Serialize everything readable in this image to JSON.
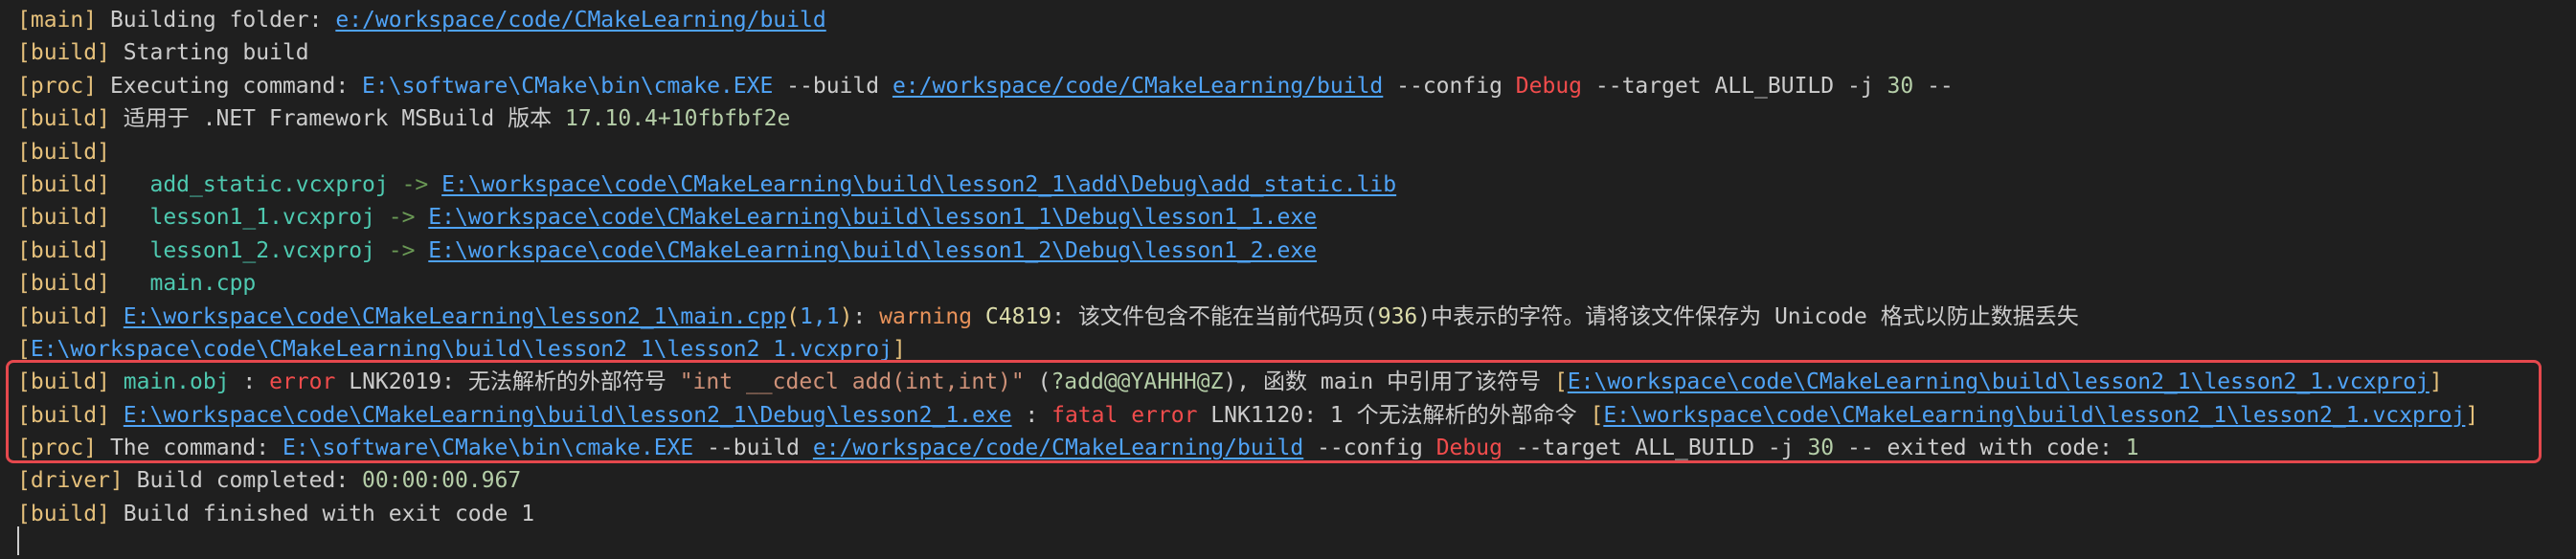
{
  "lines": [
    [
      {
        "t": "[main]",
        "c": "br"
      },
      {
        "t": " Building folder: "
      },
      {
        "t": "e:/workspace/code/CMakeLearning/build",
        "c": "path"
      }
    ],
    [
      {
        "t": "[build]",
        "c": "br"
      },
      {
        "t": " Starting build"
      }
    ],
    [
      {
        "t": "[proc]",
        "c": "br"
      },
      {
        "t": " Executing command: "
      },
      {
        "t": "E:\\software\\CMake\\bin\\cmake.EXE",
        "c": "exe"
      },
      {
        "t": " --build "
      },
      {
        "t": "e:/workspace/code/CMakeLearning/build",
        "c": "path"
      },
      {
        "t": " --config "
      },
      {
        "t": "Debug",
        "c": "red"
      },
      {
        "t": " --target ALL_BUILD -j "
      },
      {
        "t": "30",
        "c": "num"
      },
      {
        "t": " --"
      }
    ],
    [
      {
        "t": "[build]",
        "c": "br"
      },
      {
        "t": " 适用于 .NET Framework MSBuild 版本 "
      },
      {
        "t": "17.10.4+10fbfbf2e",
        "c": "num"
      }
    ],
    [
      {
        "t": "[build]",
        "c": "br"
      }
    ],
    [
      {
        "t": "[build]",
        "c": "br"
      },
      {
        "t": "   "
      },
      {
        "t": "add_static.vcxproj",
        "c": "proj"
      },
      {
        "t": " -> ",
        "c": "arrow"
      },
      {
        "t": "E:\\workspace\\code\\CMakeLearning\\build\\lesson2_1\\add\\Debug\\add_static.lib",
        "c": "path"
      }
    ],
    [
      {
        "t": "[build]",
        "c": "br"
      },
      {
        "t": "   "
      },
      {
        "t": "lesson1_1.vcxproj",
        "c": "proj"
      },
      {
        "t": " -> ",
        "c": "arrow"
      },
      {
        "t": "E:\\workspace\\code\\CMakeLearning\\build\\lesson1_1\\Debug\\lesson1_1.exe",
        "c": "path"
      }
    ],
    [
      {
        "t": "[build]",
        "c": "br"
      },
      {
        "t": "   "
      },
      {
        "t": "lesson1_2.vcxproj",
        "c": "proj"
      },
      {
        "t": " -> ",
        "c": "arrow"
      },
      {
        "t": "E:\\workspace\\code\\CMakeLearning\\build\\lesson1_2\\Debug\\lesson1_2.exe",
        "c": "path"
      }
    ],
    [
      {
        "t": "[build]",
        "c": "br"
      },
      {
        "t": "   "
      },
      {
        "t": "main.cpp",
        "c": "proj"
      }
    ],
    [
      {
        "t": "[build]",
        "c": "br"
      },
      {
        "t": " "
      },
      {
        "t": "E:\\workspace\\code\\CMakeLearning\\lesson2_1\\main.cpp",
        "c": "path"
      },
      {
        "t": "(",
        "c": "br"
      },
      {
        "t": "1,1",
        "c": "exe"
      },
      {
        "t": ")",
        "c": "br"
      },
      {
        "t": ": "
      },
      {
        "t": "warning",
        "c": "warn"
      },
      {
        "t": " "
      },
      {
        "t": "C4819",
        "c": "yellow"
      },
      {
        "t": ": 该文件包含不能在当前代码页("
      },
      {
        "t": "936",
        "c": "yellow"
      },
      {
        "t": ")中表示的字符。请将该文件保存为 Unicode 格式以防止数据丢失"
      }
    ],
    [
      {
        "t": "[",
        "c": "br"
      },
      {
        "t": "E:\\workspace\\code\\CMakeLearning\\build\\lesson2_1\\lesson2_1.vcxproj",
        "c": "exe"
      },
      {
        "t": "]",
        "c": "br"
      }
    ],
    [
      {
        "t": "[build]",
        "c": "br"
      },
      {
        "t": " "
      },
      {
        "t": "main.obj",
        "c": "proj"
      },
      {
        "t": " : "
      },
      {
        "t": "error",
        "c": "red"
      },
      {
        "t": " LNK2019: 无法解析的外部符号 "
      },
      {
        "t": "\"int __cdecl add(int,int)\"",
        "c": "str"
      },
      {
        "t": " ("
      },
      {
        "t": "?add@@YAHHH@Z",
        "c": "green"
      },
      {
        "t": "), 函数 main 中引用了该符号 "
      },
      {
        "t": "[",
        "c": "br"
      },
      {
        "t": "E:\\workspace\\code\\CMakeLearning\\build\\lesson2_1\\lesson2_1.vcxproj",
        "c": "path"
      },
      {
        "t": "]",
        "c": "br"
      }
    ],
    [
      {
        "t": "[build]",
        "c": "br"
      },
      {
        "t": " "
      },
      {
        "t": "E:\\workspace\\code\\CMakeLearning\\build\\lesson2_1\\Debug\\lesson2_1.exe",
        "c": "path"
      },
      {
        "t": " : "
      },
      {
        "t": "fatal error",
        "c": "red"
      },
      {
        "t": " LNK1120: 1 个无法解析的外部命令 "
      },
      {
        "t": "[",
        "c": "br"
      },
      {
        "t": "E:\\workspace\\code\\CMakeLearning\\build\\lesson2_1\\lesson2_1.vcxproj",
        "c": "path"
      },
      {
        "t": "]",
        "c": "br"
      }
    ],
    [
      {
        "t": "[proc]",
        "c": "br"
      },
      {
        "t": " The command: "
      },
      {
        "t": "E:\\software\\CMake\\bin\\cmake.EXE",
        "c": "exe"
      },
      {
        "t": " --build "
      },
      {
        "t": "e:/workspace/code/CMakeLearning/build",
        "c": "path"
      },
      {
        "t": " --config "
      },
      {
        "t": "Debug",
        "c": "red"
      },
      {
        "t": " --target ALL_BUILD -j "
      },
      {
        "t": "30",
        "c": "num"
      },
      {
        "t": " -- exited with code: "
      },
      {
        "t": "1",
        "c": "num"
      }
    ],
    [
      {
        "t": "[driver]",
        "c": "br"
      },
      {
        "t": " Build completed: "
      },
      {
        "t": "00:00:00.967",
        "c": "num"
      }
    ],
    [
      {
        "t": "[build]",
        "c": "br"
      },
      {
        "t": " Build finished with exit code 1"
      }
    ]
  ],
  "colors": {
    "background": "#1f1f1f",
    "highlight_border": "#e5484d"
  }
}
